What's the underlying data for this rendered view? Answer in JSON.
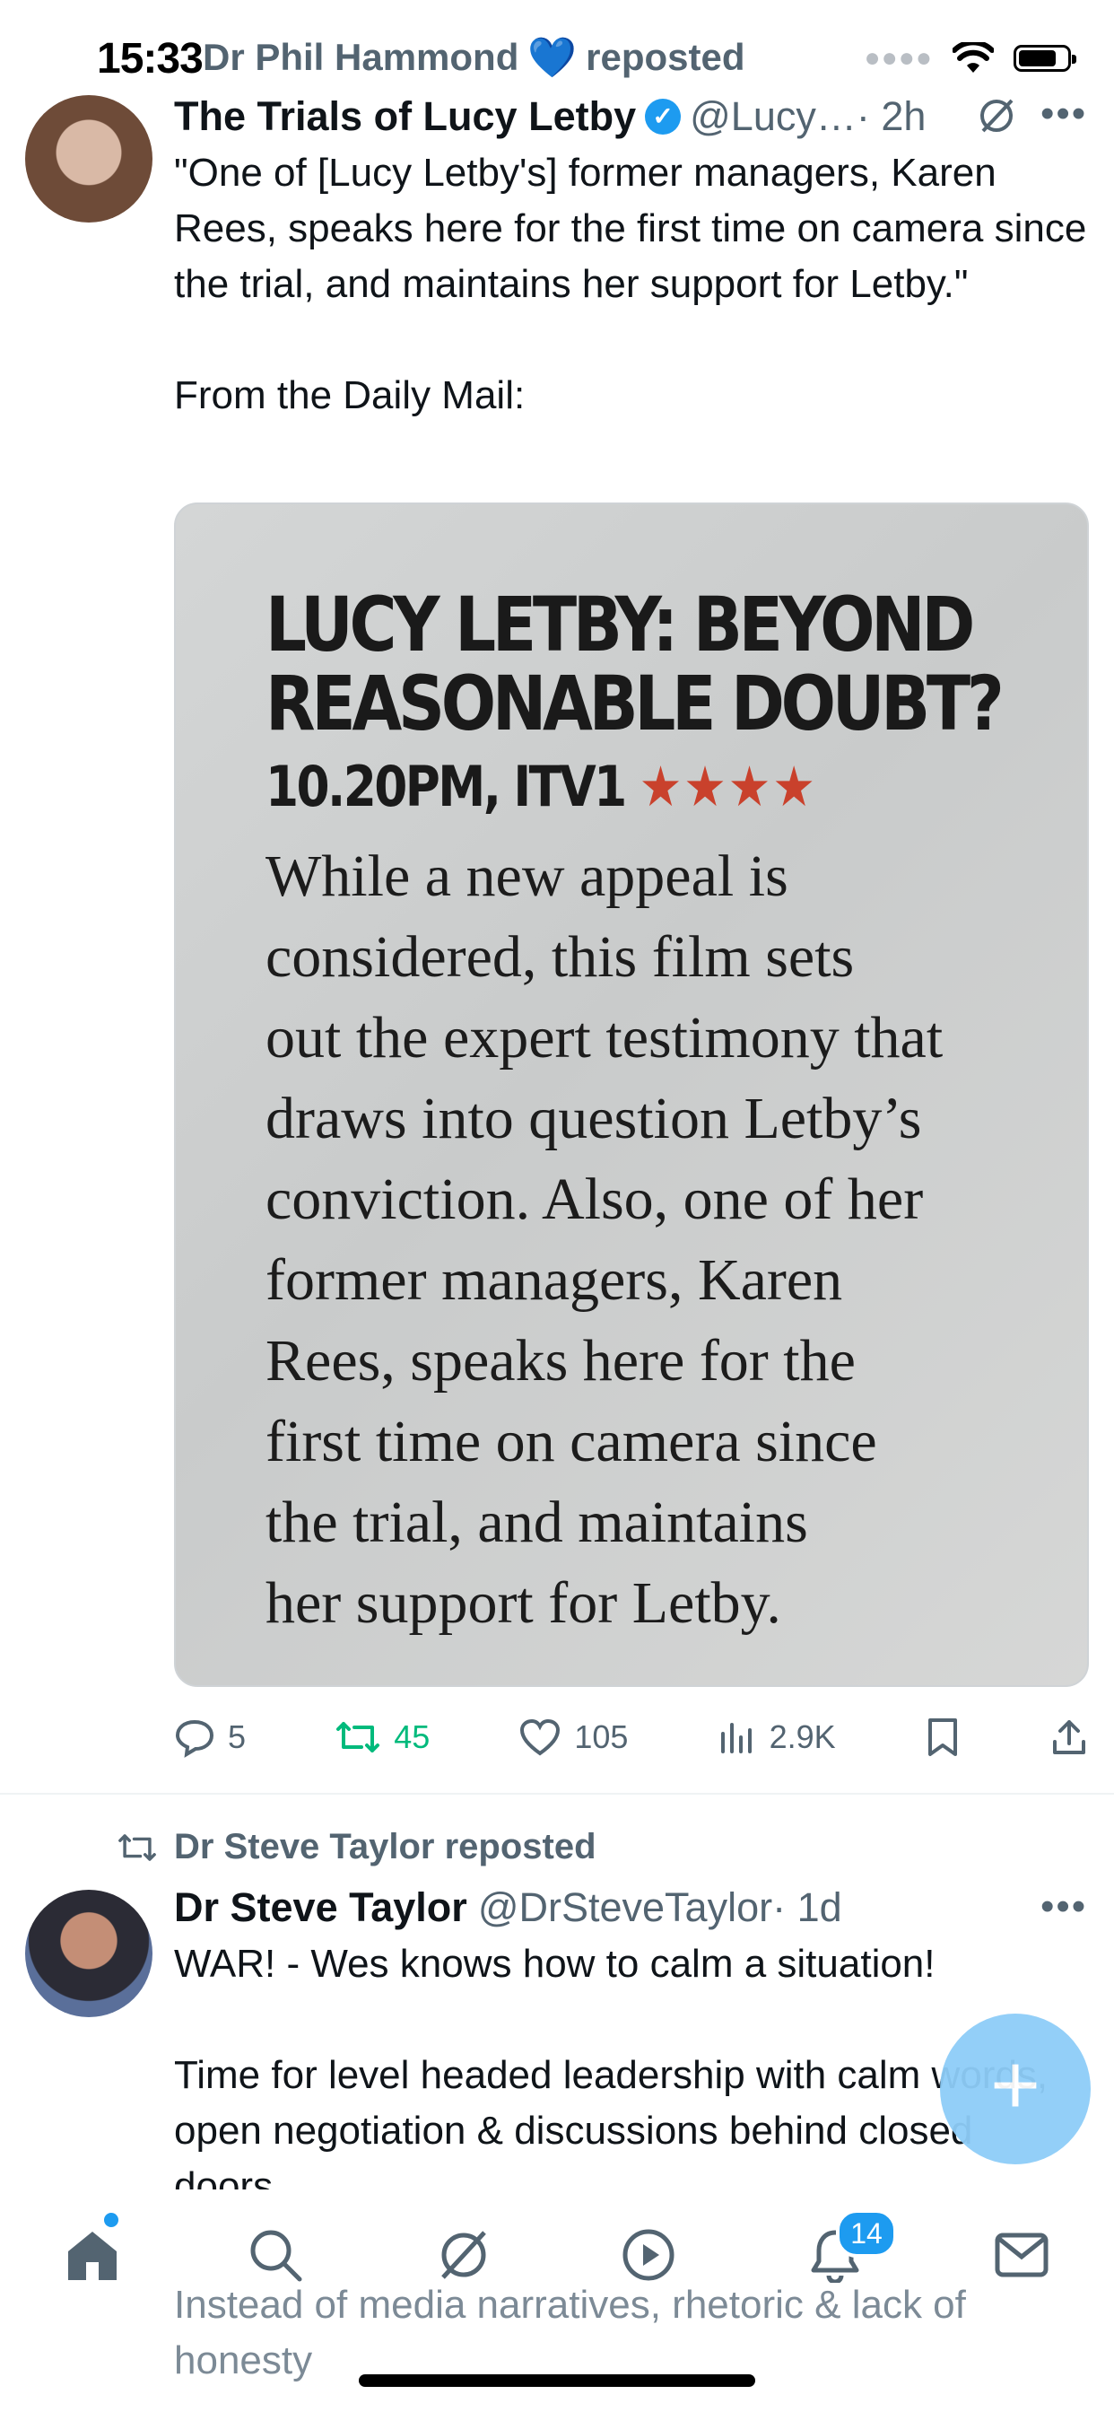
{
  "status_bar": {
    "time": "15:33"
  },
  "tweet1": {
    "repost_by": "Dr Phil Hammond",
    "repost_suffix": "reposted",
    "author_name": "The Trials of Lucy Letby",
    "handle": "@Lucy…",
    "time": "· 2h",
    "text": "\"One of [Lucy Letby's] former managers, Karen Rees, speaks here for the first time on camera since the trial, and maintains her support for Letby.\"\n\nFrom the Daily Mail:",
    "clipping": {
      "headline": "LUCY LETBY: BEYOND\nREASONABLE DOUBT?",
      "time_channel": "10.20PM, ITV1",
      "stars": "★★★★",
      "body": "While a new appeal is\nconsidered, this film sets\nout the expert testimony that\ndraws into question Letby’s\nconviction. Also, one of her\nformer managers, Karen\nRees, speaks here for the\nfirst time on camera since\nthe trial, and maintains\nher support for Letby."
    },
    "replies": "5",
    "retweets": "45",
    "likes": "105",
    "views": "2.9K"
  },
  "tweet2": {
    "repost_label": "Dr Steve Taylor reposted",
    "author_name": "Dr Steve Taylor",
    "handle": "@DrSteveTaylor",
    "time": "· 1d",
    "text": "WAR! - Wes knows how to calm a situation!\n\nTime for level headed leadership with calm words, open negotiation & discussions behind closed doors",
    "text_overflow": "Instead of media narratives, rhetoric & lack of\nhonesty"
  },
  "fab": {
    "label": "+"
  },
  "bottom_nav": {
    "notifications_badge": "14"
  },
  "colors": {
    "accent": "#1d9bf0",
    "retweet": "#00ba7c",
    "muted": "#536471"
  }
}
